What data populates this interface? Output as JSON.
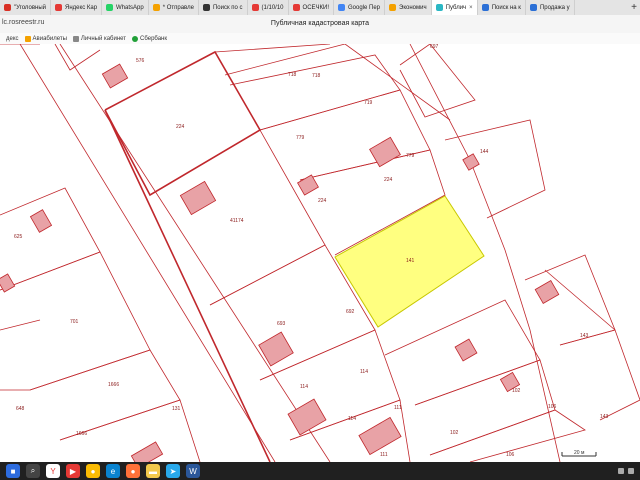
{
  "browser": {
    "tabs": [
      {
        "label": "\"Уголовный",
        "color": "#d93025"
      },
      {
        "label": "Яндекс Кар",
        "color": "#e53935"
      },
      {
        "label": "WhatsApp",
        "color": "#25d366"
      },
      {
        "label": "* Отправле",
        "color": "#f4a100"
      },
      {
        "label": "Поиск по с",
        "color": "#333333"
      },
      {
        "label": "(1/10/10",
        "color": "#e53935"
      },
      {
        "label": "ОСЕЧКИ!",
        "color": "#e53935"
      },
      {
        "label": "Google Пер",
        "color": "#4285f4"
      },
      {
        "label": "Экономич",
        "color": "#f4a100"
      },
      {
        "label": "Публич",
        "color": "#2bb7c4",
        "active": true
      },
      {
        "label": "Поиск на к",
        "color": "#2b6fd6"
      },
      {
        "label": "Продажа у",
        "color": "#2b6fd6"
      }
    ],
    "new_tab": "+",
    "tab_close": "×",
    "url": "lc.rosreestr.ru",
    "page_title": "Публичная кадастровая карта",
    "bookmarks": [
      "декс",
      "Авиабилеты",
      "Личный кабинет",
      "Сбербанк"
    ]
  },
  "map": {
    "labels": [
      "576",
      "718",
      "697",
      "718",
      "224",
      "719",
      "779",
      "224",
      "144",
      "41174",
      "224",
      "625",
      "701",
      "143",
      "693",
      "692",
      "114",
      "114",
      "1666",
      "131",
      "111",
      "102",
      "106",
      "102",
      "111",
      "106",
      "143",
      "114",
      "648",
      "779",
      "141",
      "1666"
    ],
    "scale": "20 м",
    "colors": {
      "boundary": "#c0282d",
      "building_fill": "#e8a2a6",
      "selected_fill": "#ffff80",
      "selected_stroke": "#c8c800"
    }
  },
  "taskbar": {
    "icons": [
      "start-icon",
      "search-icon",
      "yandex-icon",
      "app-icon",
      "chrome-icon",
      "edge-icon",
      "firefox-icon",
      "files-icon",
      "telegram-icon",
      "word-icon"
    ]
  }
}
